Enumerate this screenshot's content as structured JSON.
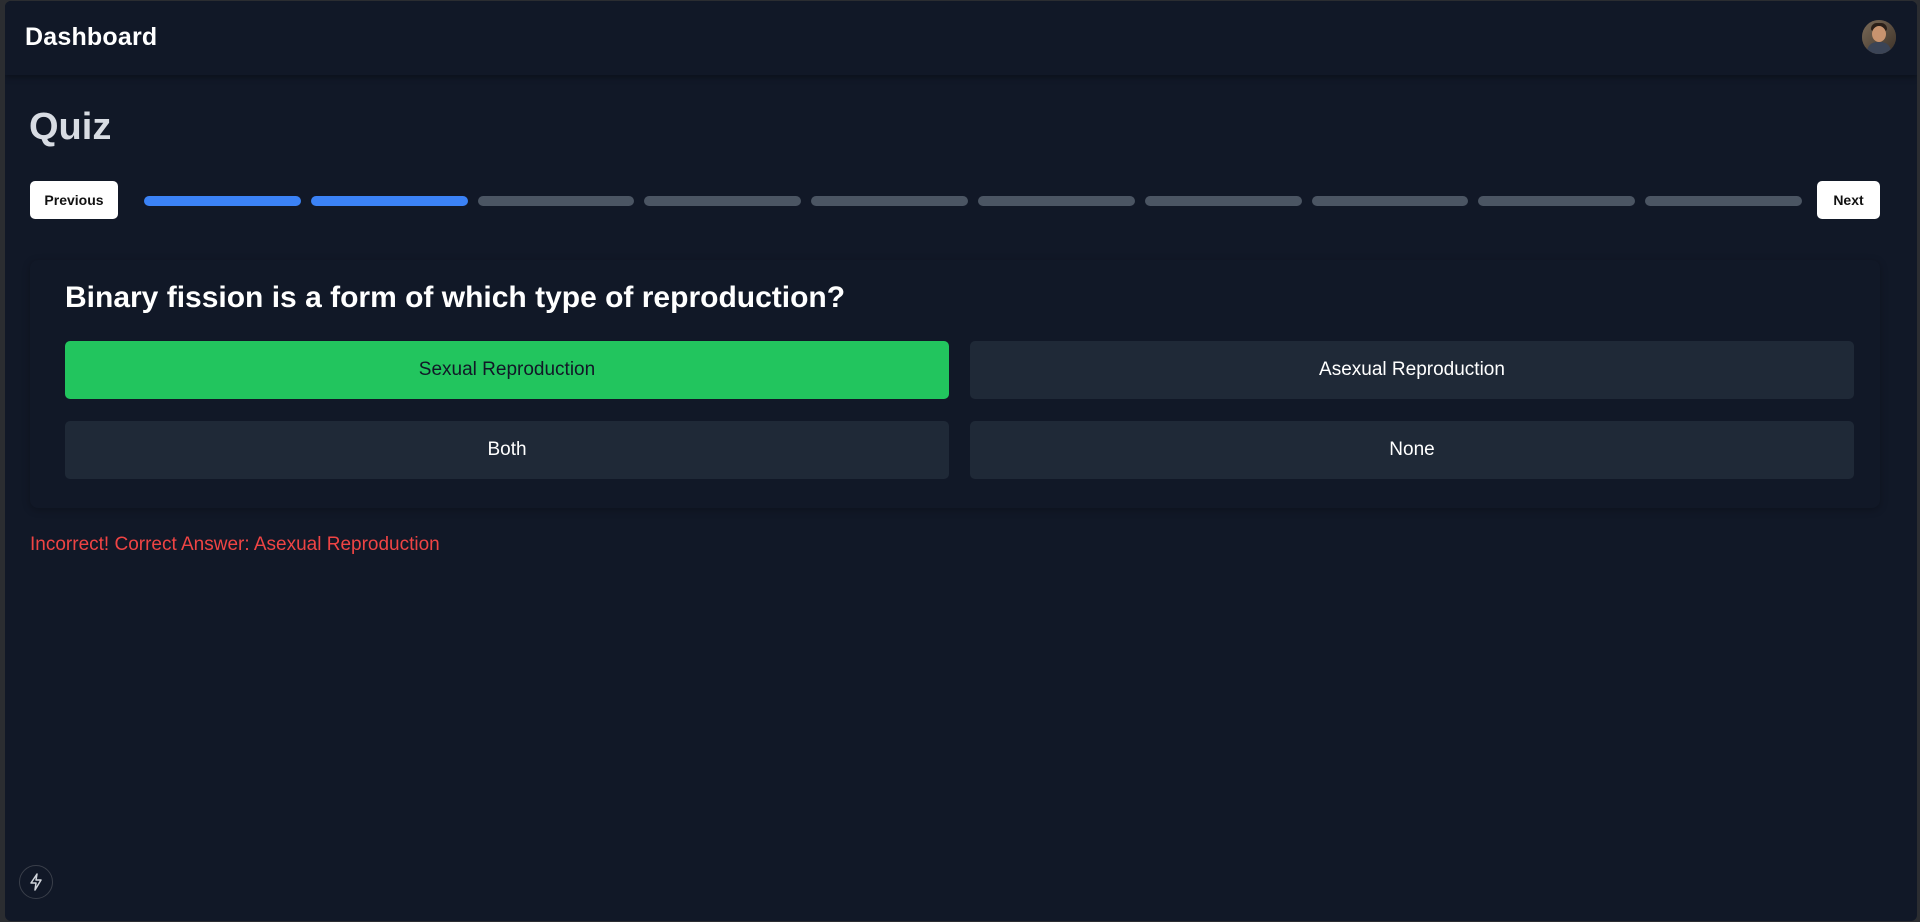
{
  "header": {
    "title": "Dashboard",
    "avatar_icon": "user-avatar"
  },
  "quiz": {
    "title": "Quiz",
    "previous_label": "Previous",
    "next_label": "Next",
    "progress": {
      "total_questions": 10,
      "completed": 2
    },
    "question": "Binary fission is a form of which type of reproduction?",
    "options": [
      {
        "label": "Sexual Reproduction",
        "selected": true
      },
      {
        "label": "Asexual Reproduction",
        "selected": false
      },
      {
        "label": "Both",
        "selected": false
      },
      {
        "label": "None",
        "selected": false
      }
    ],
    "feedback": "Incorrect! Correct Answer: Asexual Reproduction"
  },
  "colors": {
    "background": "#111827",
    "progress_done": "#3b82f6",
    "progress_todo": "#4b5563",
    "selected_option": "#22c55e",
    "option_default": "#1f2937",
    "error_text": "#ef4444"
  },
  "floating_button_icon": "lightning-bolt-icon"
}
